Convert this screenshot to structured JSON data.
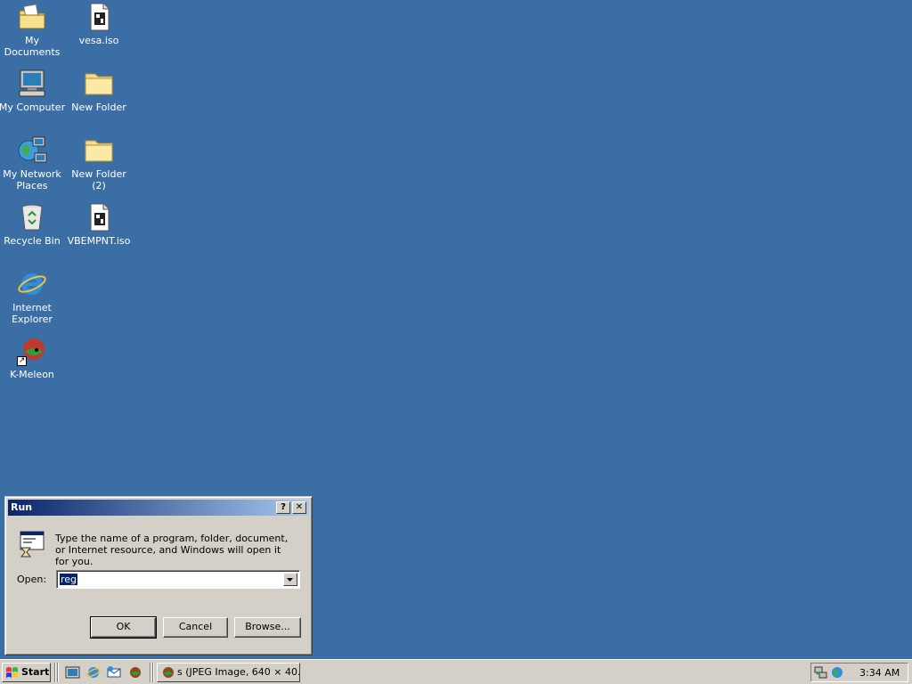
{
  "desktop": {
    "icons": [
      {
        "label": "My Documents",
        "icon": "my-documents-icon"
      },
      {
        "label": "vesa.iso",
        "icon": "iso-file-icon"
      },
      {
        "label": "My Computer",
        "icon": "my-computer-icon"
      },
      {
        "label": "New Folder",
        "icon": "folder-icon"
      },
      {
        "label": "My Network Places",
        "icon": "network-places-icon"
      },
      {
        "label": "New Folder (2)",
        "icon": "folder-icon"
      },
      {
        "label": "Recycle Bin",
        "icon": "recycle-bin-icon"
      },
      {
        "label": "VBEMPNT.iso",
        "icon": "iso-file-icon"
      },
      {
        "label": "Internet Explorer",
        "icon": "internet-explorer-icon"
      },
      {
        "label": "K-Meleon",
        "icon": "k-meleon-icon"
      }
    ]
  },
  "run_dialog": {
    "title": "Run",
    "help_glyph": "?",
    "close_glyph": "✕",
    "description": "Type the name of a program, folder, document, or Internet resource, and Windows will open it for you.",
    "open_label": "Open:",
    "open_value": "reg",
    "ok_label": "OK",
    "cancel_label": "Cancel",
    "browse_label": "Browse..."
  },
  "taskbar": {
    "start_label": "Start",
    "task_label": "s (JPEG Image, 640 × 40...",
    "clock": "3:34 AM"
  },
  "colors": {
    "desktop": "#3a6ea5",
    "title_active_start": "#0a246a",
    "title_active_end": "#a6caf0",
    "face": "#d4d0c8"
  }
}
